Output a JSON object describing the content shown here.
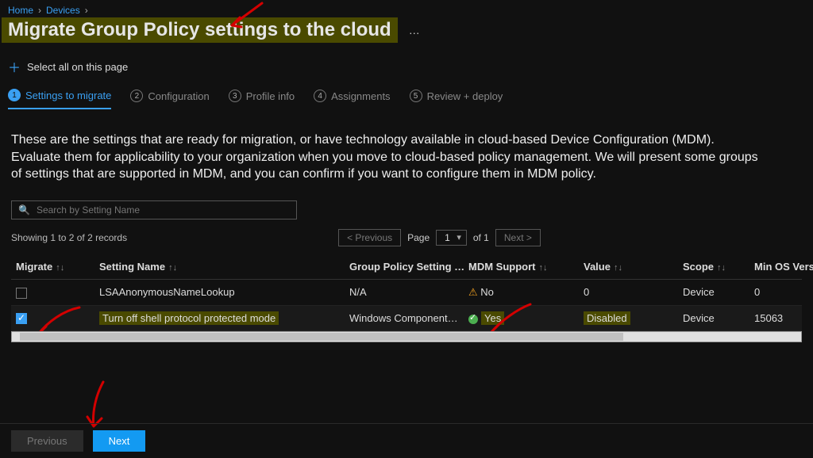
{
  "breadcrumb": {
    "home": "Home",
    "devices": "Devices"
  },
  "title": "Migrate Group Policy settings to the cloud",
  "title_more": "…",
  "toolbar": {
    "select_all": "Select all on this page"
  },
  "steps": {
    "s1": "Settings to migrate",
    "s2": "Configuration",
    "s3": "Profile info",
    "s4": "Assignments",
    "s5": "Review + deploy"
  },
  "description": "These are the settings that are ready for migration, or have technology available in cloud-based Device Configuration (MDM). Evaluate them for applicability to your organization when you move to cloud-based policy management. We will present some groups of settings that are supported in MDM, and you can confirm if you want to configure them in MDM policy.",
  "search": {
    "placeholder": "Search by Setting Name"
  },
  "records_text": "Showing 1 to 2 of 2 records",
  "pager": {
    "prev": "< Previous",
    "page_label": "Page",
    "page_value": "1",
    "of_text": "of 1",
    "next": "Next >"
  },
  "columns": {
    "migrate": "Migrate",
    "name": "Setting Name",
    "gp": "Group Policy Setting …",
    "mdm": "MDM Support",
    "value": "Value",
    "scope": "Scope",
    "minos": "Min OS Vers"
  },
  "rows": [
    {
      "migrate": false,
      "name": "LSAAnonymousNameLookup",
      "gp": "N/A",
      "mdm": "No",
      "value": "0",
      "scope": "Device",
      "minos": "0"
    },
    {
      "migrate": true,
      "name": "Turn off shell protocol protected mode",
      "gp": "Windows Components/File …",
      "mdm": "Yes",
      "value": "Disabled",
      "scope": "Device",
      "minos": "15063"
    }
  ],
  "footer": {
    "prev": "Previous",
    "next": "Next"
  },
  "colors": {
    "accent": "#3aa0f3",
    "highlight": "#4a4a00"
  }
}
